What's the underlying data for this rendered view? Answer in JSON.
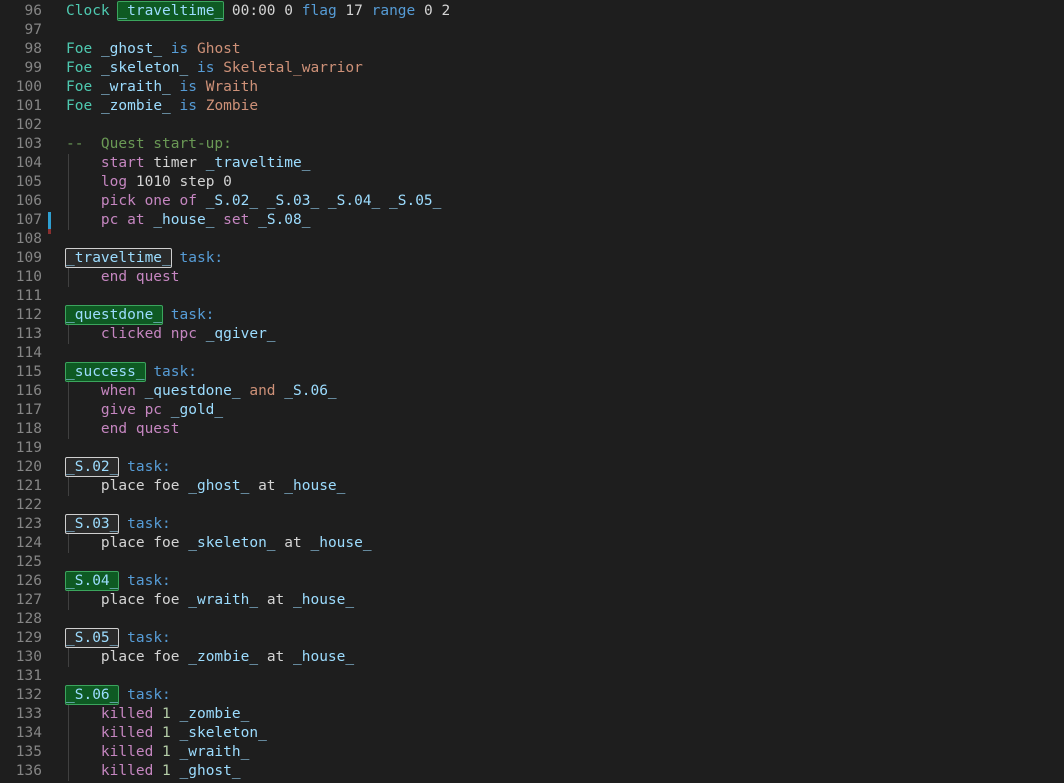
{
  "editor": {
    "theme": "dark-plus",
    "background": "#1e1e1e",
    "gutter_color": "#858585",
    "first_line": 96,
    "last_line": 136,
    "cursor": {
      "line": 107,
      "color": "#2f9fd0"
    },
    "colors": {
      "keyword": "#569cd6",
      "type": "#4ec9b0",
      "variable": "#9cdcfe",
      "string": "#ce9178",
      "number": "#b5cea8",
      "control": "#c586c0",
      "comment": "#6a9955",
      "plain": "#d4d4d4",
      "highlight_green_bg": "#0e5a23",
      "highlight_green_border": "#3ba55d",
      "highlight_dark_bg": "#2a2a2a",
      "highlight_dark_border": "#cfcfcf",
      "indent_guide": "#404040"
    }
  },
  "lines": [
    {
      "n": 96,
      "indent": 0,
      "guide": false,
      "tokens": [
        {
          "t": "Clock",
          "c": "type"
        },
        {
          "t": " ",
          "c": "plain"
        },
        {
          "t": "_traveltime_",
          "c": "var",
          "hl": "green"
        },
        {
          "t": " ",
          "c": "plain"
        },
        {
          "t": "00:00",
          "c": "plain"
        },
        {
          "t": " ",
          "c": "plain"
        },
        {
          "t": "0",
          "c": "plain"
        },
        {
          "t": " ",
          "c": "plain"
        },
        {
          "t": "flag",
          "c": "keyword"
        },
        {
          "t": " ",
          "c": "plain"
        },
        {
          "t": "17",
          "c": "plain"
        },
        {
          "t": " ",
          "c": "plain"
        },
        {
          "t": "range",
          "c": "keyword"
        },
        {
          "t": " ",
          "c": "plain"
        },
        {
          "t": "0 2",
          "c": "plain"
        }
      ]
    },
    {
      "n": 97,
      "indent": 0,
      "guide": false,
      "tokens": []
    },
    {
      "n": 98,
      "indent": 0,
      "guide": false,
      "tokens": [
        {
          "t": "Foe",
          "c": "type"
        },
        {
          "t": " ",
          "c": "plain"
        },
        {
          "t": "_ghost_",
          "c": "var"
        },
        {
          "t": " ",
          "c": "plain"
        },
        {
          "t": "is",
          "c": "keyword"
        },
        {
          "t": " ",
          "c": "plain"
        },
        {
          "t": "Ghost",
          "c": "string"
        }
      ]
    },
    {
      "n": 99,
      "indent": 0,
      "guide": false,
      "tokens": [
        {
          "t": "Foe",
          "c": "type"
        },
        {
          "t": " ",
          "c": "plain"
        },
        {
          "t": "_skeleton_",
          "c": "var"
        },
        {
          "t": " ",
          "c": "plain"
        },
        {
          "t": "is",
          "c": "keyword"
        },
        {
          "t": " ",
          "c": "plain"
        },
        {
          "t": "Skeletal_warrior",
          "c": "string"
        }
      ]
    },
    {
      "n": 100,
      "indent": 0,
      "guide": false,
      "tokens": [
        {
          "t": "Foe",
          "c": "type"
        },
        {
          "t": " ",
          "c": "plain"
        },
        {
          "t": "_wraith_",
          "c": "var"
        },
        {
          "t": " ",
          "c": "plain"
        },
        {
          "t": "is",
          "c": "keyword"
        },
        {
          "t": " ",
          "c": "plain"
        },
        {
          "t": "Wraith",
          "c": "string"
        }
      ]
    },
    {
      "n": 101,
      "indent": 0,
      "guide": false,
      "tokens": [
        {
          "t": "Foe",
          "c": "type"
        },
        {
          "t": " ",
          "c": "plain"
        },
        {
          "t": "_zombie_",
          "c": "var"
        },
        {
          "t": " ",
          "c": "plain"
        },
        {
          "t": "is",
          "c": "keyword"
        },
        {
          "t": " ",
          "c": "plain"
        },
        {
          "t": "Zombie",
          "c": "string"
        }
      ]
    },
    {
      "n": 102,
      "indent": 0,
      "guide": false,
      "tokens": []
    },
    {
      "n": 103,
      "indent": 0,
      "guide": false,
      "tokens": [
        {
          "t": "--  Quest start-up:",
          "c": "comment"
        }
      ]
    },
    {
      "n": 104,
      "indent": 1,
      "guide": true,
      "tokens": [
        {
          "t": "    ",
          "c": "plain"
        },
        {
          "t": "start",
          "c": "control"
        },
        {
          "t": " ",
          "c": "plain"
        },
        {
          "t": "timer",
          "c": "plain"
        },
        {
          "t": " ",
          "c": "plain"
        },
        {
          "t": "_traveltime_",
          "c": "var"
        }
      ]
    },
    {
      "n": 105,
      "indent": 1,
      "guide": true,
      "tokens": [
        {
          "t": "    ",
          "c": "plain"
        },
        {
          "t": "log",
          "c": "control"
        },
        {
          "t": " ",
          "c": "plain"
        },
        {
          "t": "1010",
          "c": "plain"
        },
        {
          "t": " ",
          "c": "plain"
        },
        {
          "t": "step",
          "c": "plain"
        },
        {
          "t": " ",
          "c": "plain"
        },
        {
          "t": "0",
          "c": "plain"
        }
      ]
    },
    {
      "n": 106,
      "indent": 1,
      "guide": true,
      "tokens": [
        {
          "t": "    ",
          "c": "plain"
        },
        {
          "t": "pick one of",
          "c": "control"
        },
        {
          "t": " ",
          "c": "plain"
        },
        {
          "t": "_S.02_ _S.03_ _S.04_ _S.05_",
          "c": "var"
        }
      ]
    },
    {
      "n": 107,
      "indent": 1,
      "guide": true,
      "cursor": true,
      "tokens": [
        {
          "t": "    ",
          "c": "plain"
        },
        {
          "t": "pc at",
          "c": "control"
        },
        {
          "t": " ",
          "c": "plain"
        },
        {
          "t": "_house_",
          "c": "var"
        },
        {
          "t": " ",
          "c": "plain"
        },
        {
          "t": "set",
          "c": "control"
        },
        {
          "t": " ",
          "c": "plain"
        },
        {
          "t": "_S.08_",
          "c": "var"
        }
      ]
    },
    {
      "n": 108,
      "indent": 0,
      "guide": false,
      "tokens": []
    },
    {
      "n": 109,
      "indent": 0,
      "guide": false,
      "tokens": [
        {
          "t": "_traveltime_",
          "c": "var",
          "hl": "dark"
        },
        {
          "t": " ",
          "c": "plain"
        },
        {
          "t": "task:",
          "c": "keyword"
        }
      ]
    },
    {
      "n": 110,
      "indent": 1,
      "guide": true,
      "tokens": [
        {
          "t": "    ",
          "c": "plain"
        },
        {
          "t": "end quest",
          "c": "control"
        }
      ]
    },
    {
      "n": 111,
      "indent": 0,
      "guide": false,
      "tokens": []
    },
    {
      "n": 112,
      "indent": 0,
      "guide": false,
      "tokens": [
        {
          "t": "_questdone_",
          "c": "var",
          "hl": "green"
        },
        {
          "t": " ",
          "c": "plain"
        },
        {
          "t": "task:",
          "c": "keyword"
        }
      ]
    },
    {
      "n": 113,
      "indent": 1,
      "guide": true,
      "tokens": [
        {
          "t": "    ",
          "c": "plain"
        },
        {
          "t": "clicked npc",
          "c": "control"
        },
        {
          "t": " ",
          "c": "plain"
        },
        {
          "t": "_qgiver_",
          "c": "var"
        }
      ]
    },
    {
      "n": 114,
      "indent": 0,
      "guide": false,
      "tokens": []
    },
    {
      "n": 115,
      "indent": 0,
      "guide": false,
      "tokens": [
        {
          "t": "_success_",
          "c": "var",
          "hl": "green"
        },
        {
          "t": " ",
          "c": "plain"
        },
        {
          "t": "task:",
          "c": "keyword"
        }
      ]
    },
    {
      "n": 116,
      "indent": 1,
      "guide": true,
      "tokens": [
        {
          "t": "    ",
          "c": "plain"
        },
        {
          "t": "when",
          "c": "control"
        },
        {
          "t": " ",
          "c": "plain"
        },
        {
          "t": "_questdone_",
          "c": "var"
        },
        {
          "t": " ",
          "c": "plain"
        },
        {
          "t": "and",
          "c": "string"
        },
        {
          "t": " ",
          "c": "plain"
        },
        {
          "t": "_S.06_",
          "c": "var"
        }
      ]
    },
    {
      "n": 117,
      "indent": 1,
      "guide": true,
      "tokens": [
        {
          "t": "    ",
          "c": "plain"
        },
        {
          "t": "give pc",
          "c": "control"
        },
        {
          "t": " ",
          "c": "plain"
        },
        {
          "t": "_gold_",
          "c": "var"
        }
      ]
    },
    {
      "n": 118,
      "indent": 1,
      "guide": true,
      "tokens": [
        {
          "t": "    ",
          "c": "plain"
        },
        {
          "t": "end quest",
          "c": "control"
        }
      ]
    },
    {
      "n": 119,
      "indent": 0,
      "guide": false,
      "tokens": []
    },
    {
      "n": 120,
      "indent": 0,
      "guide": false,
      "tokens": [
        {
          "t": "_S.02_",
          "c": "var",
          "hl": "dark"
        },
        {
          "t": " ",
          "c": "plain"
        },
        {
          "t": "task:",
          "c": "keyword"
        }
      ]
    },
    {
      "n": 121,
      "indent": 1,
      "guide": true,
      "tokens": [
        {
          "t": "    ",
          "c": "plain"
        },
        {
          "t": "place foe",
          "c": "plain"
        },
        {
          "t": " ",
          "c": "plain"
        },
        {
          "t": "_ghost_",
          "c": "var"
        },
        {
          "t": " ",
          "c": "plain"
        },
        {
          "t": "at",
          "c": "plain"
        },
        {
          "t": " ",
          "c": "plain"
        },
        {
          "t": "_house_",
          "c": "var"
        }
      ]
    },
    {
      "n": 122,
      "indent": 0,
      "guide": false,
      "tokens": []
    },
    {
      "n": 123,
      "indent": 0,
      "guide": false,
      "tokens": [
        {
          "t": "_S.03_",
          "c": "var",
          "hl": "dark"
        },
        {
          "t": " ",
          "c": "plain"
        },
        {
          "t": "task:",
          "c": "keyword"
        }
      ]
    },
    {
      "n": 124,
      "indent": 1,
      "guide": true,
      "tokens": [
        {
          "t": "    ",
          "c": "plain"
        },
        {
          "t": "place foe",
          "c": "plain"
        },
        {
          "t": " ",
          "c": "plain"
        },
        {
          "t": "_skeleton_",
          "c": "var"
        },
        {
          "t": " ",
          "c": "plain"
        },
        {
          "t": "at",
          "c": "plain"
        },
        {
          "t": " ",
          "c": "plain"
        },
        {
          "t": "_house_",
          "c": "var"
        }
      ]
    },
    {
      "n": 125,
      "indent": 0,
      "guide": false,
      "tokens": []
    },
    {
      "n": 126,
      "indent": 0,
      "guide": false,
      "tokens": [
        {
          "t": "_S.04_",
          "c": "var",
          "hl": "green"
        },
        {
          "t": " ",
          "c": "plain"
        },
        {
          "t": "task:",
          "c": "keyword"
        }
      ]
    },
    {
      "n": 127,
      "indent": 1,
      "guide": true,
      "tokens": [
        {
          "t": "    ",
          "c": "plain"
        },
        {
          "t": "place foe",
          "c": "plain"
        },
        {
          "t": " ",
          "c": "plain"
        },
        {
          "t": "_wraith_",
          "c": "var"
        },
        {
          "t": " ",
          "c": "plain"
        },
        {
          "t": "at",
          "c": "plain"
        },
        {
          "t": " ",
          "c": "plain"
        },
        {
          "t": "_house_",
          "c": "var"
        }
      ]
    },
    {
      "n": 128,
      "indent": 0,
      "guide": false,
      "tokens": []
    },
    {
      "n": 129,
      "indent": 0,
      "guide": false,
      "tokens": [
        {
          "t": "_S.05_",
          "c": "var",
          "hl": "dark"
        },
        {
          "t": " ",
          "c": "plain"
        },
        {
          "t": "task:",
          "c": "keyword"
        }
      ]
    },
    {
      "n": 130,
      "indent": 1,
      "guide": true,
      "tokens": [
        {
          "t": "    ",
          "c": "plain"
        },
        {
          "t": "place foe",
          "c": "plain"
        },
        {
          "t": " ",
          "c": "plain"
        },
        {
          "t": "_zombie_",
          "c": "var"
        },
        {
          "t": " ",
          "c": "plain"
        },
        {
          "t": "at",
          "c": "plain"
        },
        {
          "t": " ",
          "c": "plain"
        },
        {
          "t": "_house_",
          "c": "var"
        }
      ]
    },
    {
      "n": 131,
      "indent": 0,
      "guide": false,
      "tokens": []
    },
    {
      "n": 132,
      "indent": 0,
      "guide": false,
      "tokens": [
        {
          "t": "_S.06_",
          "c": "var",
          "hl": "green"
        },
        {
          "t": " ",
          "c": "plain"
        },
        {
          "t": "task:",
          "c": "keyword"
        }
      ]
    },
    {
      "n": 133,
      "indent": 1,
      "guide": true,
      "tokens": [
        {
          "t": "    ",
          "c": "plain"
        },
        {
          "t": "killed",
          "c": "control"
        },
        {
          "t": " ",
          "c": "plain"
        },
        {
          "t": "1",
          "c": "number"
        },
        {
          "t": " ",
          "c": "plain"
        },
        {
          "t": "_zombie_",
          "c": "var"
        }
      ]
    },
    {
      "n": 134,
      "indent": 1,
      "guide": true,
      "tokens": [
        {
          "t": "    ",
          "c": "plain"
        },
        {
          "t": "killed",
          "c": "control"
        },
        {
          "t": " ",
          "c": "plain"
        },
        {
          "t": "1",
          "c": "number"
        },
        {
          "t": " ",
          "c": "plain"
        },
        {
          "t": "_skeleton_",
          "c": "var"
        }
      ]
    },
    {
      "n": 135,
      "indent": 1,
      "guide": true,
      "tokens": [
        {
          "t": "    ",
          "c": "plain"
        },
        {
          "t": "killed",
          "c": "control"
        },
        {
          "t": " ",
          "c": "plain"
        },
        {
          "t": "1",
          "c": "number"
        },
        {
          "t": " ",
          "c": "plain"
        },
        {
          "t": "_wraith_",
          "c": "var"
        }
      ]
    },
    {
      "n": 136,
      "indent": 1,
      "guide": true,
      "tokens": [
        {
          "t": "    ",
          "c": "plain"
        },
        {
          "t": "killed",
          "c": "control"
        },
        {
          "t": " ",
          "c": "plain"
        },
        {
          "t": "1",
          "c": "number"
        },
        {
          "t": " ",
          "c": "plain"
        },
        {
          "t": "_ghost_",
          "c": "var"
        }
      ]
    }
  ]
}
